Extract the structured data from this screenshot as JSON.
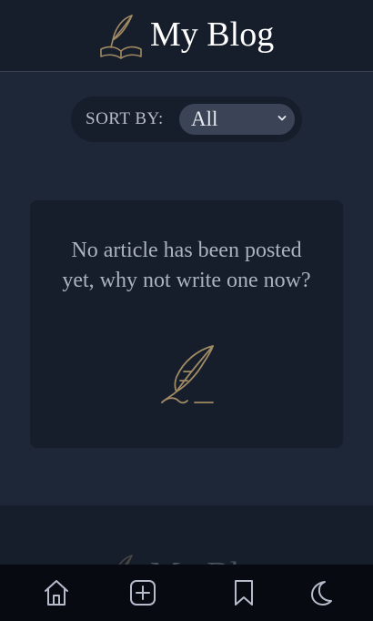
{
  "header": {
    "title": "My Blog",
    "logo_icon": "quill-book-icon"
  },
  "sort": {
    "label": "SORT BY:",
    "selected": "All"
  },
  "empty_state": {
    "message": "No article has been posted yet, why not write one now?",
    "icon": "quill-icon"
  },
  "footer": {
    "title": "My Blog"
  },
  "bottom_nav": {
    "items": [
      {
        "icon": "home-icon"
      },
      {
        "icon": "add-post-icon"
      },
      {
        "icon": "bookmark-icon"
      },
      {
        "icon": "moon-icon"
      }
    ]
  },
  "colors": {
    "background": "#1e2738",
    "surface": "#161d2b",
    "nav": "#070a10",
    "accent_gold": "#a08a63",
    "text_muted": "#aab2c2"
  }
}
